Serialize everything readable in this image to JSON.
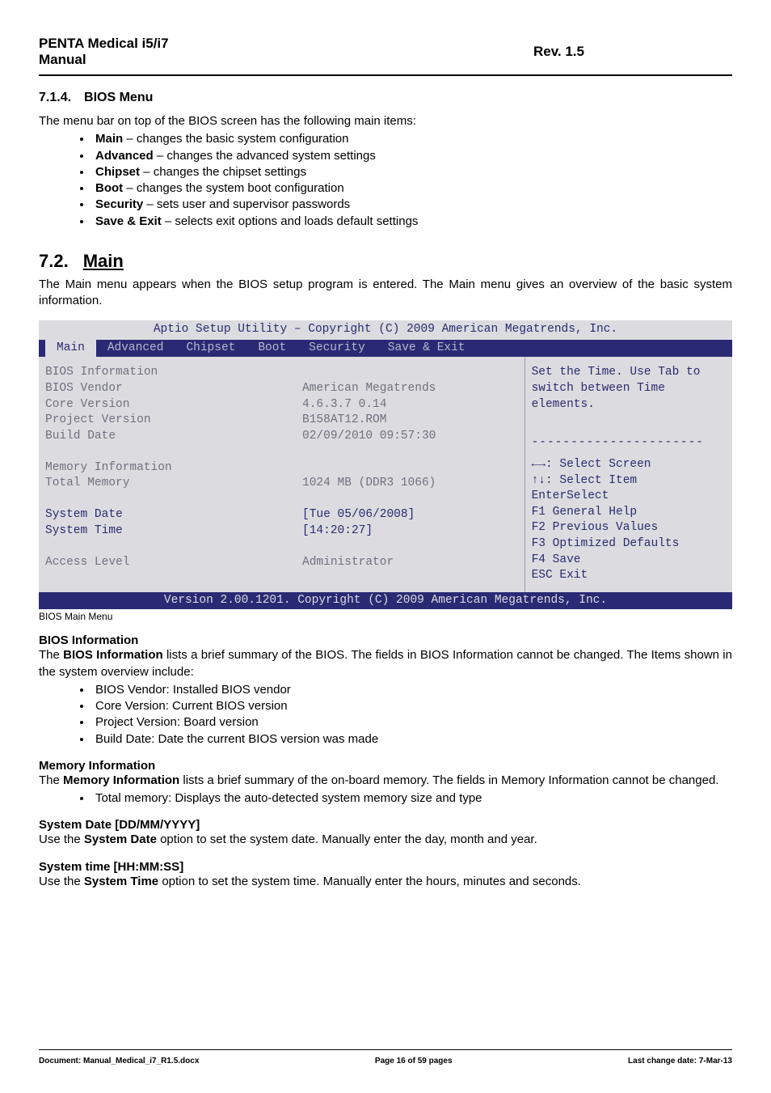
{
  "header": {
    "left_line1": "PENTA Medical i5/i7",
    "left_line2": "Manual",
    "right": "Rev. 1.5"
  },
  "s714": {
    "num": "7.1.4.",
    "title": "BIOS Menu",
    "intro": "The menu bar on top of the BIOS screen has the following main items:",
    "items": [
      {
        "b": "Main",
        "rest": " – changes the basic system configuration"
      },
      {
        "b": "Advanced",
        "rest": " – changes the advanced system settings"
      },
      {
        "b": "Chipset",
        "rest": " – changes the chipset settings"
      },
      {
        "b": "Boot",
        "rest": " – changes the system boot configuration"
      },
      {
        "b": "Security",
        "rest": " – sets user and supervisor passwords"
      },
      {
        "b": "Save & Exit",
        "rest": " – selects exit options and loads default settings"
      }
    ]
  },
  "s72": {
    "num": "7.2.",
    "title": "Main",
    "intro": "The Main menu appears when the BIOS setup program is entered. The Main menu gives an overview of the basic system information."
  },
  "bios": {
    "title": "Aptio Setup Utility – Copyright (C) 2009 American Megatrends, Inc.",
    "tabs": [
      "Main",
      "Advanced",
      "Chipset",
      "Boot",
      "Security",
      "Save & Exit"
    ],
    "left": {
      "l1": "BIOS Information",
      "l2": "BIOS Vendor",
      "l3": "Core Version",
      "l4": "Project Version",
      "l5": "Build Date",
      "l6": "",
      "l7": "Memory Information",
      "l8": "Total Memory",
      "l9": "",
      "l10": "System Date",
      "l11": "System Time",
      "l12": "",
      "l13": "Access Level"
    },
    "mid": {
      "l1": "",
      "l2": "American Megatrends",
      "l3": "4.6.3.7 0.14",
      "l4": "B158AT12.ROM",
      "l5": "02/09/2010 09:57:30",
      "l6": "",
      "l7": "",
      "l8": "1024 MB (DDR3 1066)",
      "l9": "",
      "l10": "[Tue 05/06/2008]",
      "l11": "[14:20:27]",
      "l12": "",
      "l13": "Administrator"
    },
    "right": {
      "help1": "Set the Time. Use Tab to",
      "help2": "switch between Time",
      "help3": "elements.",
      "dash": "----------------------",
      "k1": "←→: Select Screen",
      "k2": "↑↓: Select Item",
      "k3": "EnterSelect",
      "k4": "F1   General Help",
      "k5": "F2   Previous Values",
      "k6": "F3   Optimized Defaults",
      "k7": "F4   Save",
      "k8": "ESC  Exit"
    },
    "footer": "Version 2.00.1201. Copyright (C) 2009 American Megatrends, Inc.",
    "caption": "BIOS Main Menu"
  },
  "biosinfo": {
    "head": "BIOS Information",
    "p1a": "The ",
    "p1b": "BIOS Information",
    "p1c": " lists a brief summary of the BIOS. The fields in BIOS Information cannot be changed. The Items shown in the system overview include:",
    "items": [
      "BIOS Vendor: Installed BIOS vendor",
      "Core Version: Current BIOS version",
      "Project Version: Board version",
      "Build Date: Date the current BIOS version was made"
    ]
  },
  "meminfo": {
    "head": "Memory Information",
    "p1a": "The ",
    "p1b": "Memory Information",
    "p1c": " lists a brief summary of the on-board memory. The fields in Memory Information cannot be changed.",
    "items": [
      "Total memory: Displays the auto-detected system memory size and type"
    ]
  },
  "sysdate": {
    "head": "System Date [DD/MM/YYYY]",
    "p1a": "Use the ",
    "p1b": "System Date",
    "p1c": " option to set the system date. Manually enter the day, month and year."
  },
  "systime": {
    "head": "System time [HH:MM:SS]",
    "p1a": "Use the ",
    "p1b": "System Time",
    "p1c": " option to set the system time. Manually enter the hours, minutes and seconds."
  },
  "footer": {
    "left": "Document: Manual_Medical_i7_R1.5.docx",
    "center": "Page 16 of 59 pages",
    "right": "Last change date: 7-Mar-13"
  }
}
